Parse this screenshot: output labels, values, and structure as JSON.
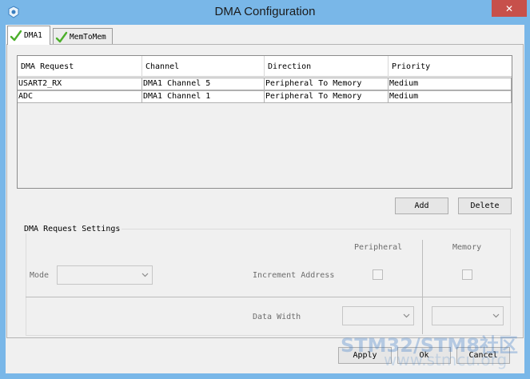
{
  "window": {
    "title": "DMA Configuration",
    "close_glyph": "✕"
  },
  "tabs": [
    {
      "label": "DMA1",
      "icon": "green-check-icon",
      "active": true
    },
    {
      "label": "MemToMem",
      "icon": "green-check-icon",
      "active": false
    }
  ],
  "table": {
    "columns": [
      "DMA Request",
      "Channel",
      "Direction",
      "Priority"
    ],
    "rows": [
      [
        "USART2_RX",
        "DMA1 Channel 5",
        "Peripheral To Memory",
        "Medium"
      ],
      [
        "ADC",
        "DMA1 Channel 1",
        "Peripheral To Memory",
        "Medium"
      ]
    ]
  },
  "actions": {
    "add": "Add",
    "delete": "Delete"
  },
  "settings": {
    "title": "DMA Request Settings",
    "mode_label": "Mode",
    "peripheral_label": "Peripheral",
    "memory_label": "Memory",
    "increment_label": "Increment Address",
    "data_width_label": "Data Width"
  },
  "footer": {
    "apply": "Apply",
    "ok": "Ok",
    "cancel": "Cancel"
  },
  "watermark": {
    "line1": "STM32/STM8社区",
    "line2": "www.stmcu.org"
  },
  "colors": {
    "titlebar": "#79b7e8",
    "close": "#c7504b",
    "panel": "#f0f0f0",
    "check": "#4caf2b"
  }
}
